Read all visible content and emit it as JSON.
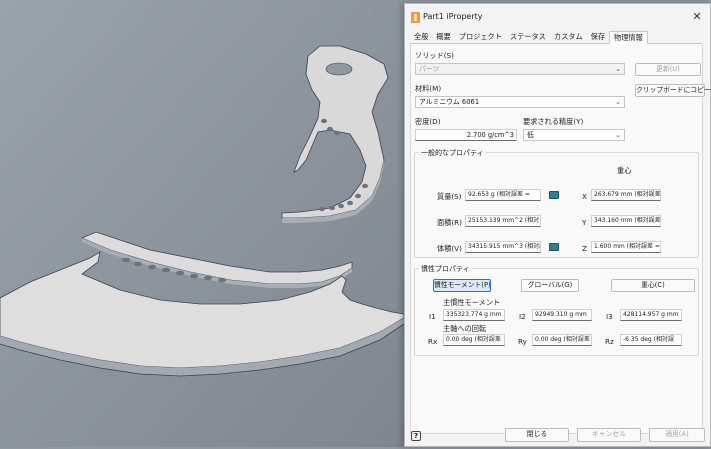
{
  "dialog": {
    "title": "Part1 iProperty",
    "close_icon": "close-icon"
  },
  "tabs": [
    "全般",
    "概要",
    "プロジェクト",
    "ステータス",
    "カスタム",
    "保存",
    "物理情報"
  ],
  "active_tab": "物理情報",
  "solid": {
    "label": "ソリッド(S)",
    "value": "パーツ",
    "update_label": "更新(U)"
  },
  "material": {
    "label": "材料(M)",
    "value": "アルミニウム 6061",
    "clipboard_label": "クリップボードにコピー(O)"
  },
  "density": {
    "label": "密度(D)",
    "value": "2.700 g/cm^3"
  },
  "accuracy": {
    "label": "要求される精度(Y)",
    "value": "低"
  },
  "general": {
    "title": "一般的なプロパティ",
    "mass_label": "質量(S)",
    "mass_value": "92.653 g (相対誤差 =",
    "area_label": "面積(R)",
    "area_value": "25153.139 mm^2 (相対",
    "volume_label": "体積(V)",
    "volume_value": "34315.915 mm^3 (相対誤",
    "cog_title": "重心",
    "x_label": "X",
    "x_value": "263.679 mm (相対誤差",
    "y_label": "Y",
    "y_value": "343.160 mm (相対誤差",
    "z_label": "Z",
    "z_value": "1.600 mm (相対誤差 ="
  },
  "inertia": {
    "title": "慣性プロパティ",
    "moment_button": "慣性モーメント(P)",
    "global_button": "グローバル(G)",
    "cog_button": "重心(C)",
    "principal_title": "主慣性モーメント",
    "i1_label": "I1",
    "i1_value": "335323.774 g mm",
    "i2_label": "I2",
    "i2_value": "92949.310 g mm",
    "i3_label": "I3",
    "i3_value": "428114.957 g mm",
    "rotation_title": "主軸への回転",
    "rx_label": "Rx",
    "rx_value": "0.00 deg (相対誤差",
    "ry_label": "Ry",
    "ry_value": "0.00 deg (相対誤差",
    "rz_label": "Rz",
    "rz_value": "-6.35 deg (相対誤"
  },
  "footer": {
    "help_icon": "?",
    "close_label": "閉じる",
    "cancel_label": "キャンセル",
    "apply_label": "適用(A)"
  },
  "colors": {
    "viewport_bg": "#8f979f",
    "part_face": "#dcdcdc",
    "part_side": "#aab0b6",
    "part_edge": "#3a3f5c",
    "accent": "#2a6fd0"
  }
}
